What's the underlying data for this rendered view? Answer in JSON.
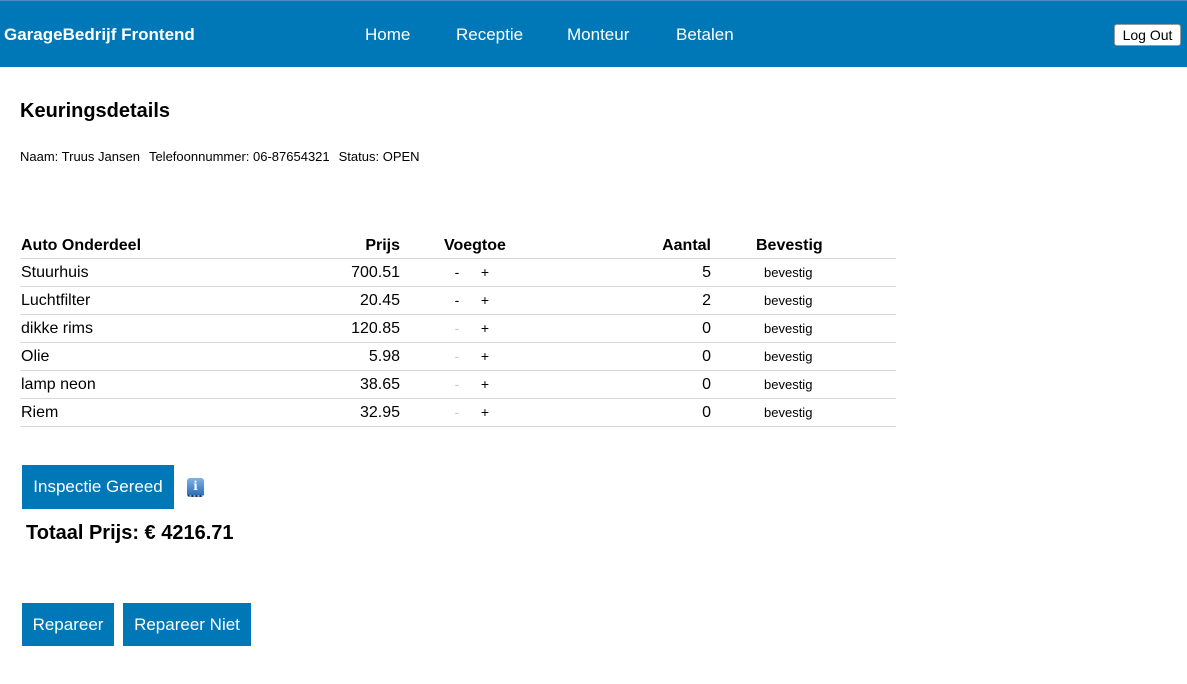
{
  "nav": {
    "brand": "GarageBedrijf Frontend",
    "links": [
      "Home",
      "Receptie",
      "Monteur",
      "Betalen"
    ],
    "logout_label": "Log Out"
  },
  "page": {
    "title": "Keuringsdetails",
    "naam": "Naam: Truus Jansen",
    "telefoon": "Telefoonnummer: 06-87654321",
    "status": "Status: OPEN"
  },
  "table": {
    "headers": {
      "onderdeel": "Auto Onderdeel",
      "prijs": "Prijs",
      "voegtoe": "Voegtoe",
      "aantal": "Aantal",
      "bevestig": "Bevestig"
    },
    "minus_label": "-",
    "plus_label": "+",
    "confirm_label": "bevestig",
    "rows": [
      {
        "name": "Stuurhuis",
        "price": "700.51",
        "qty": "5"
      },
      {
        "name": "Luchtfilter",
        "price": "20.45",
        "qty": "2"
      },
      {
        "name": "dikke rims",
        "price": "120.85",
        "qty": "0"
      },
      {
        "name": "Olie",
        "price": "5.98",
        "qty": "0"
      },
      {
        "name": "lamp neon",
        "price": "38.65",
        "qty": "0"
      },
      {
        "name": "Riem",
        "price": "32.95",
        "qty": "0"
      }
    ]
  },
  "actions": {
    "gereed_label": "Inspectie Gereed",
    "info_icon": "i",
    "total": "Totaal Prijs: € 4216.71",
    "repareer_label": "Repareer",
    "repareer_niet_label": "Repareer Niet"
  },
  "colors": {
    "primary": "#0077b6",
    "disabled_text": "#c8c8c8"
  }
}
